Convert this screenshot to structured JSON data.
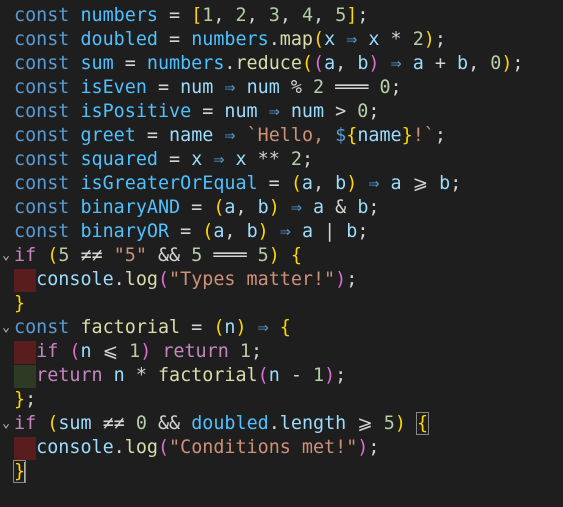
{
  "editor": {
    "lines": [
      {
        "tokens": [
          [
            "kw",
            "const"
          ],
          [
            "op",
            " "
          ],
          [
            "cst",
            "numbers"
          ],
          [
            "op",
            " = "
          ],
          [
            "b1",
            "["
          ],
          [
            "num",
            "1"
          ],
          [
            "op",
            ", "
          ],
          [
            "num",
            "2"
          ],
          [
            "op",
            ", "
          ],
          [
            "num",
            "3"
          ],
          [
            "op",
            ", "
          ],
          [
            "num",
            "4"
          ],
          [
            "op",
            ", "
          ],
          [
            "num",
            "5"
          ],
          [
            "b1",
            "]"
          ],
          [
            "op",
            ";"
          ]
        ]
      },
      {
        "tokens": [
          [
            "kw",
            "const"
          ],
          [
            "op",
            " "
          ],
          [
            "cst",
            "doubled"
          ],
          [
            "op",
            " = "
          ],
          [
            "cst",
            "numbers"
          ],
          [
            "op",
            "."
          ],
          [
            "fn",
            "map"
          ],
          [
            "b1",
            "("
          ],
          [
            "var",
            "x"
          ],
          [
            "op",
            " "
          ],
          [
            "kw",
            "⇒"
          ],
          [
            "op",
            " "
          ],
          [
            "var",
            "x"
          ],
          [
            "op",
            " * "
          ],
          [
            "num",
            "2"
          ],
          [
            "b1",
            ")"
          ],
          [
            "op",
            ";"
          ]
        ]
      },
      {
        "tokens": [
          [
            "kw",
            "const"
          ],
          [
            "op",
            " "
          ],
          [
            "cst",
            "sum"
          ],
          [
            "op",
            " = "
          ],
          [
            "cst",
            "numbers"
          ],
          [
            "op",
            "."
          ],
          [
            "fn",
            "reduce"
          ],
          [
            "b1",
            "("
          ],
          [
            "b2",
            "("
          ],
          [
            "var",
            "a"
          ],
          [
            "op",
            ", "
          ],
          [
            "var",
            "b"
          ],
          [
            "b2",
            ")"
          ],
          [
            "op",
            " "
          ],
          [
            "kw",
            "⇒"
          ],
          [
            "op",
            " "
          ],
          [
            "var",
            "a"
          ],
          [
            "op",
            " + "
          ],
          [
            "var",
            "b"
          ],
          [
            "op",
            ", "
          ],
          [
            "num",
            "0"
          ],
          [
            "b1",
            ")"
          ],
          [
            "op",
            ";"
          ]
        ]
      },
      {
        "tokens": [
          [
            "kw",
            "const"
          ],
          [
            "op",
            " "
          ],
          [
            "cst",
            "isEven"
          ],
          [
            "op",
            " = "
          ],
          [
            "var",
            "num"
          ],
          [
            "op",
            " "
          ],
          [
            "kw",
            "⇒"
          ],
          [
            "op",
            " "
          ],
          [
            "var",
            "num"
          ],
          [
            "op",
            " % "
          ],
          [
            "num",
            "2"
          ],
          [
            "op",
            " ═══ "
          ],
          [
            "num",
            "0"
          ],
          [
            "op",
            ";"
          ]
        ]
      },
      {
        "tokens": [
          [
            "kw",
            "const"
          ],
          [
            "op",
            " "
          ],
          [
            "cst",
            "isPositive"
          ],
          [
            "op",
            " = "
          ],
          [
            "var",
            "num"
          ],
          [
            "op",
            " "
          ],
          [
            "kw",
            "⇒"
          ],
          [
            "op",
            " "
          ],
          [
            "var",
            "num"
          ],
          [
            "op",
            " > "
          ],
          [
            "num",
            "0"
          ],
          [
            "op",
            ";"
          ]
        ]
      },
      {
        "tokens": [
          [
            "kw",
            "const"
          ],
          [
            "op",
            " "
          ],
          [
            "cst",
            "greet"
          ],
          [
            "op",
            " = "
          ],
          [
            "var",
            "name"
          ],
          [
            "op",
            " "
          ],
          [
            "kw",
            "⇒"
          ],
          [
            "op",
            " "
          ],
          [
            "str",
            "`Hello, "
          ],
          [
            "dollar",
            "$"
          ],
          [
            "b1",
            "{"
          ],
          [
            "var",
            "name"
          ],
          [
            "b1",
            "}"
          ],
          [
            "str",
            "!`"
          ],
          [
            "op",
            ";"
          ]
        ]
      },
      {
        "tokens": [
          [
            "kw",
            "const"
          ],
          [
            "op",
            " "
          ],
          [
            "cst",
            "squared"
          ],
          [
            "op",
            " = "
          ],
          [
            "var",
            "x"
          ],
          [
            "op",
            " "
          ],
          [
            "kw",
            "⇒"
          ],
          [
            "op",
            " "
          ],
          [
            "var",
            "x"
          ],
          [
            "op",
            " ** "
          ],
          [
            "num",
            "2"
          ],
          [
            "op",
            ";"
          ]
        ]
      },
      {
        "tokens": [
          [
            "kw",
            "const"
          ],
          [
            "op",
            " "
          ],
          [
            "cst",
            "isGreaterOrEqual"
          ],
          [
            "op",
            " = "
          ],
          [
            "b1",
            "("
          ],
          [
            "var",
            "a"
          ],
          [
            "op",
            ", "
          ],
          [
            "var",
            "b"
          ],
          [
            "b1",
            ")"
          ],
          [
            "op",
            " "
          ],
          [
            "kw",
            "⇒"
          ],
          [
            "op",
            " "
          ],
          [
            "var",
            "a"
          ],
          [
            "op",
            " ⩾ "
          ],
          [
            "var",
            "b"
          ],
          [
            "op",
            ";"
          ]
        ]
      },
      {
        "tokens": [
          [
            "kw",
            "const"
          ],
          [
            "op",
            " "
          ],
          [
            "cst",
            "binaryAND"
          ],
          [
            "op",
            " = "
          ],
          [
            "b1",
            "("
          ],
          [
            "var",
            "a"
          ],
          [
            "op",
            ", "
          ],
          [
            "var",
            "b"
          ],
          [
            "b1",
            ")"
          ],
          [
            "op",
            " "
          ],
          [
            "kw",
            "⇒"
          ],
          [
            "op",
            " "
          ],
          [
            "var",
            "a"
          ],
          [
            "op",
            " & "
          ],
          [
            "var",
            "b"
          ],
          [
            "op",
            ";"
          ]
        ]
      },
      {
        "tokens": [
          [
            "kw",
            "const"
          ],
          [
            "op",
            " "
          ],
          [
            "cst",
            "binaryOR"
          ],
          [
            "op",
            " = "
          ],
          [
            "b1",
            "("
          ],
          [
            "var",
            "a"
          ],
          [
            "op",
            ", "
          ],
          [
            "var",
            "b"
          ],
          [
            "b1",
            ")"
          ],
          [
            "op",
            " "
          ],
          [
            "kw",
            "⇒"
          ],
          [
            "op",
            " "
          ],
          [
            "var",
            "a"
          ],
          [
            "op",
            " | "
          ],
          [
            "var",
            "b"
          ],
          [
            "op",
            ";"
          ]
        ]
      },
      {
        "fold": true,
        "tokens": [
          [
            "ctl",
            "if"
          ],
          [
            "op",
            " "
          ],
          [
            "b1",
            "("
          ],
          [
            "num",
            "5"
          ],
          [
            "op",
            " ≠≠ "
          ],
          [
            "str",
            "\"5\""
          ],
          [
            "op",
            " && "
          ],
          [
            "num",
            "5"
          ],
          [
            "op",
            " ═══ "
          ],
          [
            "num",
            "5"
          ],
          [
            "b1",
            ")"
          ],
          [
            "op",
            " "
          ],
          [
            "b1",
            "{"
          ]
        ]
      },
      {
        "indent": "red",
        "tokens": [
          [
            "op",
            "  "
          ],
          [
            "var",
            "console"
          ],
          [
            "op",
            "."
          ],
          [
            "fn",
            "log"
          ],
          [
            "b2",
            "("
          ],
          [
            "str",
            "\"Types matter!\""
          ],
          [
            "b2",
            ")"
          ],
          [
            "op",
            ";"
          ]
        ]
      },
      {
        "tokens": [
          [
            "b1",
            "}"
          ]
        ]
      },
      {
        "fold": true,
        "tokens": [
          [
            "kw",
            "const"
          ],
          [
            "op",
            " "
          ],
          [
            "fn",
            "factorial"
          ],
          [
            "op",
            " = "
          ],
          [
            "b1",
            "("
          ],
          [
            "var",
            "n"
          ],
          [
            "b1",
            ")"
          ],
          [
            "op",
            " "
          ],
          [
            "kw",
            "⇒"
          ],
          [
            "op",
            " "
          ],
          [
            "b1",
            "{"
          ]
        ]
      },
      {
        "indent": "red",
        "tokens": [
          [
            "op",
            "  "
          ],
          [
            "ctl",
            "if"
          ],
          [
            "op",
            " "
          ],
          [
            "b2",
            "("
          ],
          [
            "var",
            "n"
          ],
          [
            "op",
            " ⩽ "
          ],
          [
            "num",
            "1"
          ],
          [
            "b2",
            ")"
          ],
          [
            "op",
            " "
          ],
          [
            "ctl",
            "return"
          ],
          [
            "op",
            " "
          ],
          [
            "num",
            "1"
          ],
          [
            "op",
            ";"
          ]
        ]
      },
      {
        "indent": "green",
        "tokens": [
          [
            "op",
            "  "
          ],
          [
            "ctl",
            "return"
          ],
          [
            "op",
            " "
          ],
          [
            "var",
            "n"
          ],
          [
            "op",
            " * "
          ],
          [
            "fn",
            "factorial"
          ],
          [
            "b2",
            "("
          ],
          [
            "var",
            "n"
          ],
          [
            "op",
            " - "
          ],
          [
            "num",
            "1"
          ],
          [
            "b2",
            ")"
          ],
          [
            "op",
            ";"
          ]
        ]
      },
      {
        "tokens": [
          [
            "b1",
            "}"
          ],
          [
            "op",
            ";"
          ]
        ]
      },
      {
        "fold": true,
        "tokens": [
          [
            "ctl",
            "if"
          ],
          [
            "op",
            " "
          ],
          [
            "b1",
            "("
          ],
          [
            "var",
            "sum"
          ],
          [
            "op",
            " ≠≠ "
          ],
          [
            "num",
            "0"
          ],
          [
            "op",
            " && "
          ],
          [
            "cst",
            "doubled"
          ],
          [
            "op",
            "."
          ],
          [
            "var",
            "length"
          ],
          [
            "op",
            " ⩾ "
          ],
          [
            "num",
            "5"
          ],
          [
            "b1",
            ")"
          ],
          [
            "op",
            " "
          ],
          [
            "b1box",
            "{"
          ]
        ]
      },
      {
        "indent": "red",
        "tokens": [
          [
            "op",
            "  "
          ],
          [
            "var",
            "console"
          ],
          [
            "op",
            "."
          ],
          [
            "fn",
            "log"
          ],
          [
            "b2",
            "("
          ],
          [
            "str",
            "\"Conditions met!\""
          ],
          [
            "b2",
            ")"
          ],
          [
            "op",
            ";"
          ]
        ]
      },
      {
        "cursor": true,
        "tokens": [
          [
            "b1box",
            "}"
          ]
        ]
      }
    ]
  },
  "icons": {
    "fold": "chevron-down-icon"
  }
}
